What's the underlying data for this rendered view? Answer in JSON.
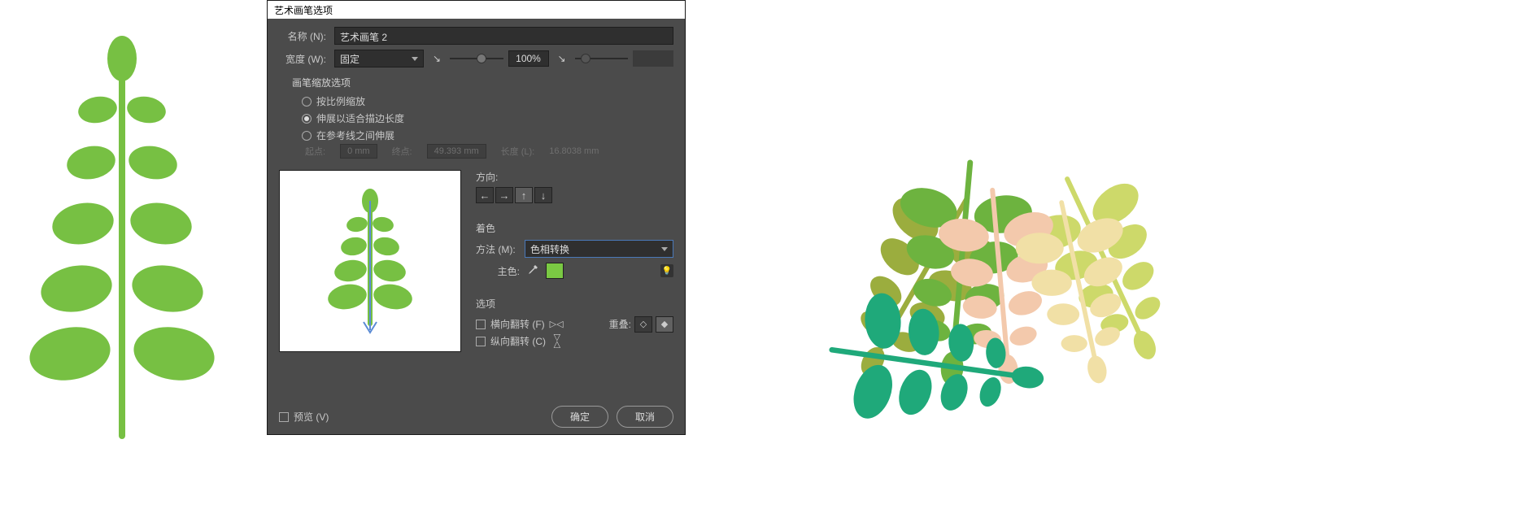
{
  "dialog": {
    "title": "艺术画笔选项",
    "name_label": "名称 (N):",
    "name_value": "艺术画笔 2",
    "width_label": "宽度 (W):",
    "width_mode": "固定",
    "width_value": "100%",
    "scale_group": {
      "title": "画笔缩放选项",
      "opt_proportional": "按比例缩放",
      "opt_stretch": "伸展以适合描边长度",
      "opt_between_guides": "在参考线之间伸展",
      "selected": "stretch"
    },
    "guides_dim": {
      "start_label": "起点:",
      "start_value": "0 mm",
      "end_label": "终点:",
      "end_value": "49.393 mm",
      "length_label": "长度 (L):",
      "length_value": "16.8038 mm"
    },
    "direction": {
      "label": "方向:",
      "buttons": [
        "←",
        "→",
        "↑",
        "↓"
      ],
      "active_index": 2
    },
    "colorize": {
      "group_label": "着色",
      "method_label": "方法 (M):",
      "method_value": "色相转换",
      "key_label": "主色:",
      "key_hex": "#7ac943"
    },
    "options": {
      "group_label": "选项",
      "flip_h": "横向翻转 (F)",
      "flip_v": "纵向翻转 (C)",
      "overlap_label": "重叠:"
    },
    "footer": {
      "preview": "预览 (V)",
      "ok": "确定",
      "cancel": "取消"
    }
  }
}
